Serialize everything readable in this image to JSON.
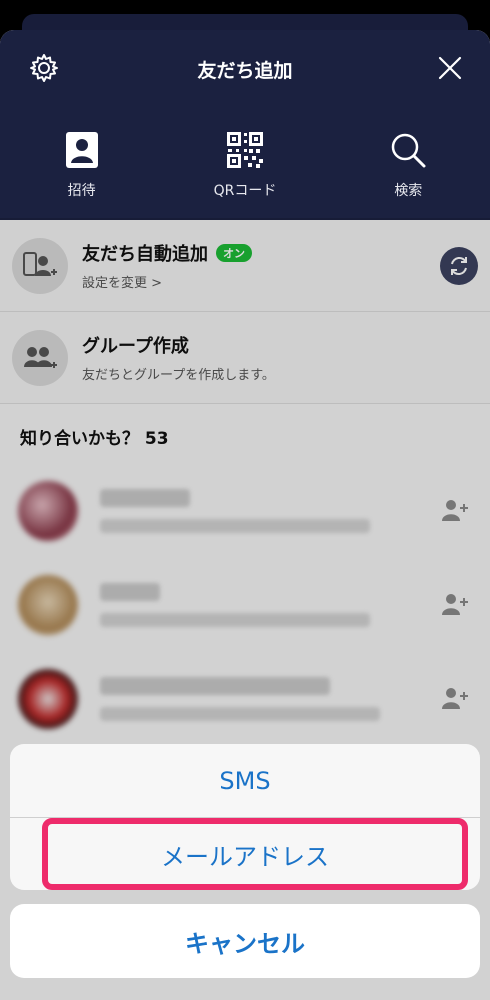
{
  "header": {
    "title": "友だち追加",
    "tabs": [
      {
        "label": "招待",
        "icon": "contact-book-icon"
      },
      {
        "label": "QRコード",
        "icon": "qr-code-icon"
      },
      {
        "label": "検索",
        "icon": "search-icon"
      }
    ]
  },
  "auto_add": {
    "title": "友だち自動追加",
    "badge": "オン",
    "subtitle": "設定を変更 >"
  },
  "group": {
    "title": "グループ作成",
    "subtitle": "友だちとグループを作成します。"
  },
  "suggestions": {
    "title": "知り合いかも？ 53"
  },
  "action_sheet": {
    "options": [
      "SMS",
      "メールアドレス"
    ],
    "cancel": "キャンセル"
  },
  "colors": {
    "header_bg": "#1b2140",
    "action_text": "#1a73c8",
    "highlight": "#ee2b6b",
    "badge_on": "#1dbb36"
  }
}
